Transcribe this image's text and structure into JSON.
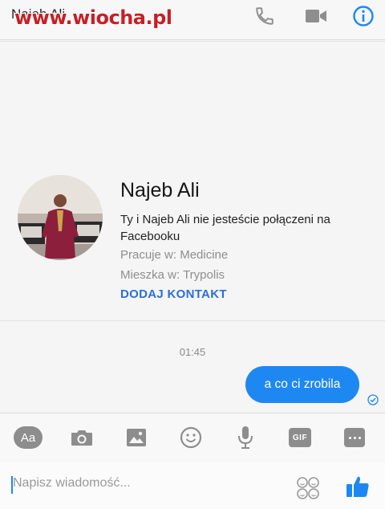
{
  "header": {
    "title": "Najeb Ali",
    "watermark": "www.wiocha.pl",
    "icons": [
      "phone-icon",
      "video-camera-icon",
      "info-icon"
    ],
    "accent_color": "#1e88f2"
  },
  "profile": {
    "name": "Najeb Ali",
    "connection_note": "Ty i Najeb Ali nie jesteście połączeni na Facebooku",
    "work": "Pracuje w: Medicine",
    "home": "Mieszka w: Trypolis",
    "add_contact_label": "DODAJ KONTAKT"
  },
  "conversation": {
    "timestamp": "01:45",
    "messages": [
      {
        "from": "me",
        "text": "a co ci zrobila"
      }
    ]
  },
  "toolbar": {
    "items": [
      "Aa",
      "camera-icon",
      "image-icon",
      "emoji-icon",
      "microphone-icon",
      "GIF",
      "more-icon"
    ],
    "aa_label": "Aa",
    "gif_label": "GIF"
  },
  "composer": {
    "placeholder": "Napisz wiadomość...",
    "value": ""
  }
}
